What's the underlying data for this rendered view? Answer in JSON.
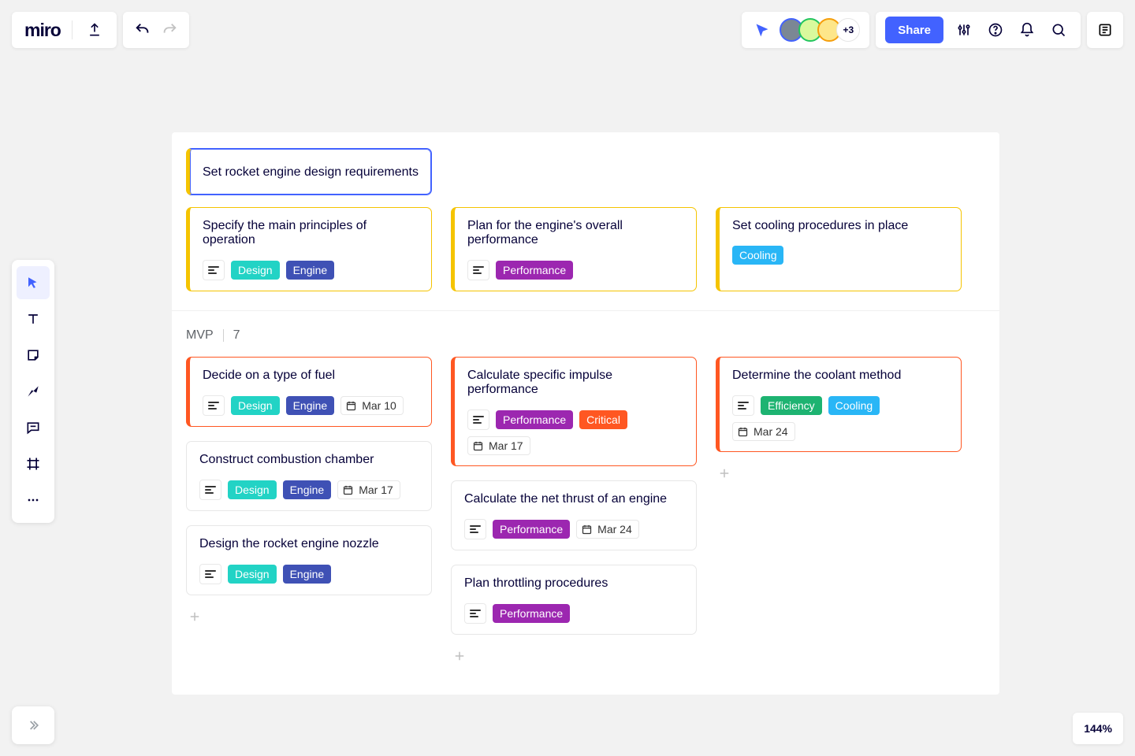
{
  "brand": "miro",
  "share_label": "Share",
  "presence_extra": "+3",
  "zoom": "144%",
  "group1": {
    "header_card": "Set rocket engine design requirements",
    "cards": [
      {
        "title": "Specify the main principles of operation"
      },
      {
        "title": "Plan for the engine's overall performance"
      },
      {
        "title": "Set cooling procedures in place"
      }
    ]
  },
  "group2": {
    "name": "MVP",
    "count": "7",
    "cols": [
      [
        {
          "title": "Decide on a type of fuel",
          "date": "Mar 10"
        },
        {
          "title": "Construct combustion chamber",
          "date": "Mar 17"
        },
        {
          "title": "Design the rocket engine nozzle"
        }
      ],
      [
        {
          "title": "Calculate specific impulse performance",
          "date": "Mar 17"
        },
        {
          "title": "Calculate the net thrust of an engine",
          "date": "Mar 24"
        },
        {
          "title": "Plan throttling procedures"
        }
      ],
      [
        {
          "title": "Determine the coolant method",
          "date": "Mar 24"
        }
      ]
    ]
  },
  "tags": {
    "design": "Design",
    "engine": "Engine",
    "performance": "Performance",
    "cooling": "Cooling",
    "critical": "Critical",
    "efficiency": "Efficiency"
  }
}
